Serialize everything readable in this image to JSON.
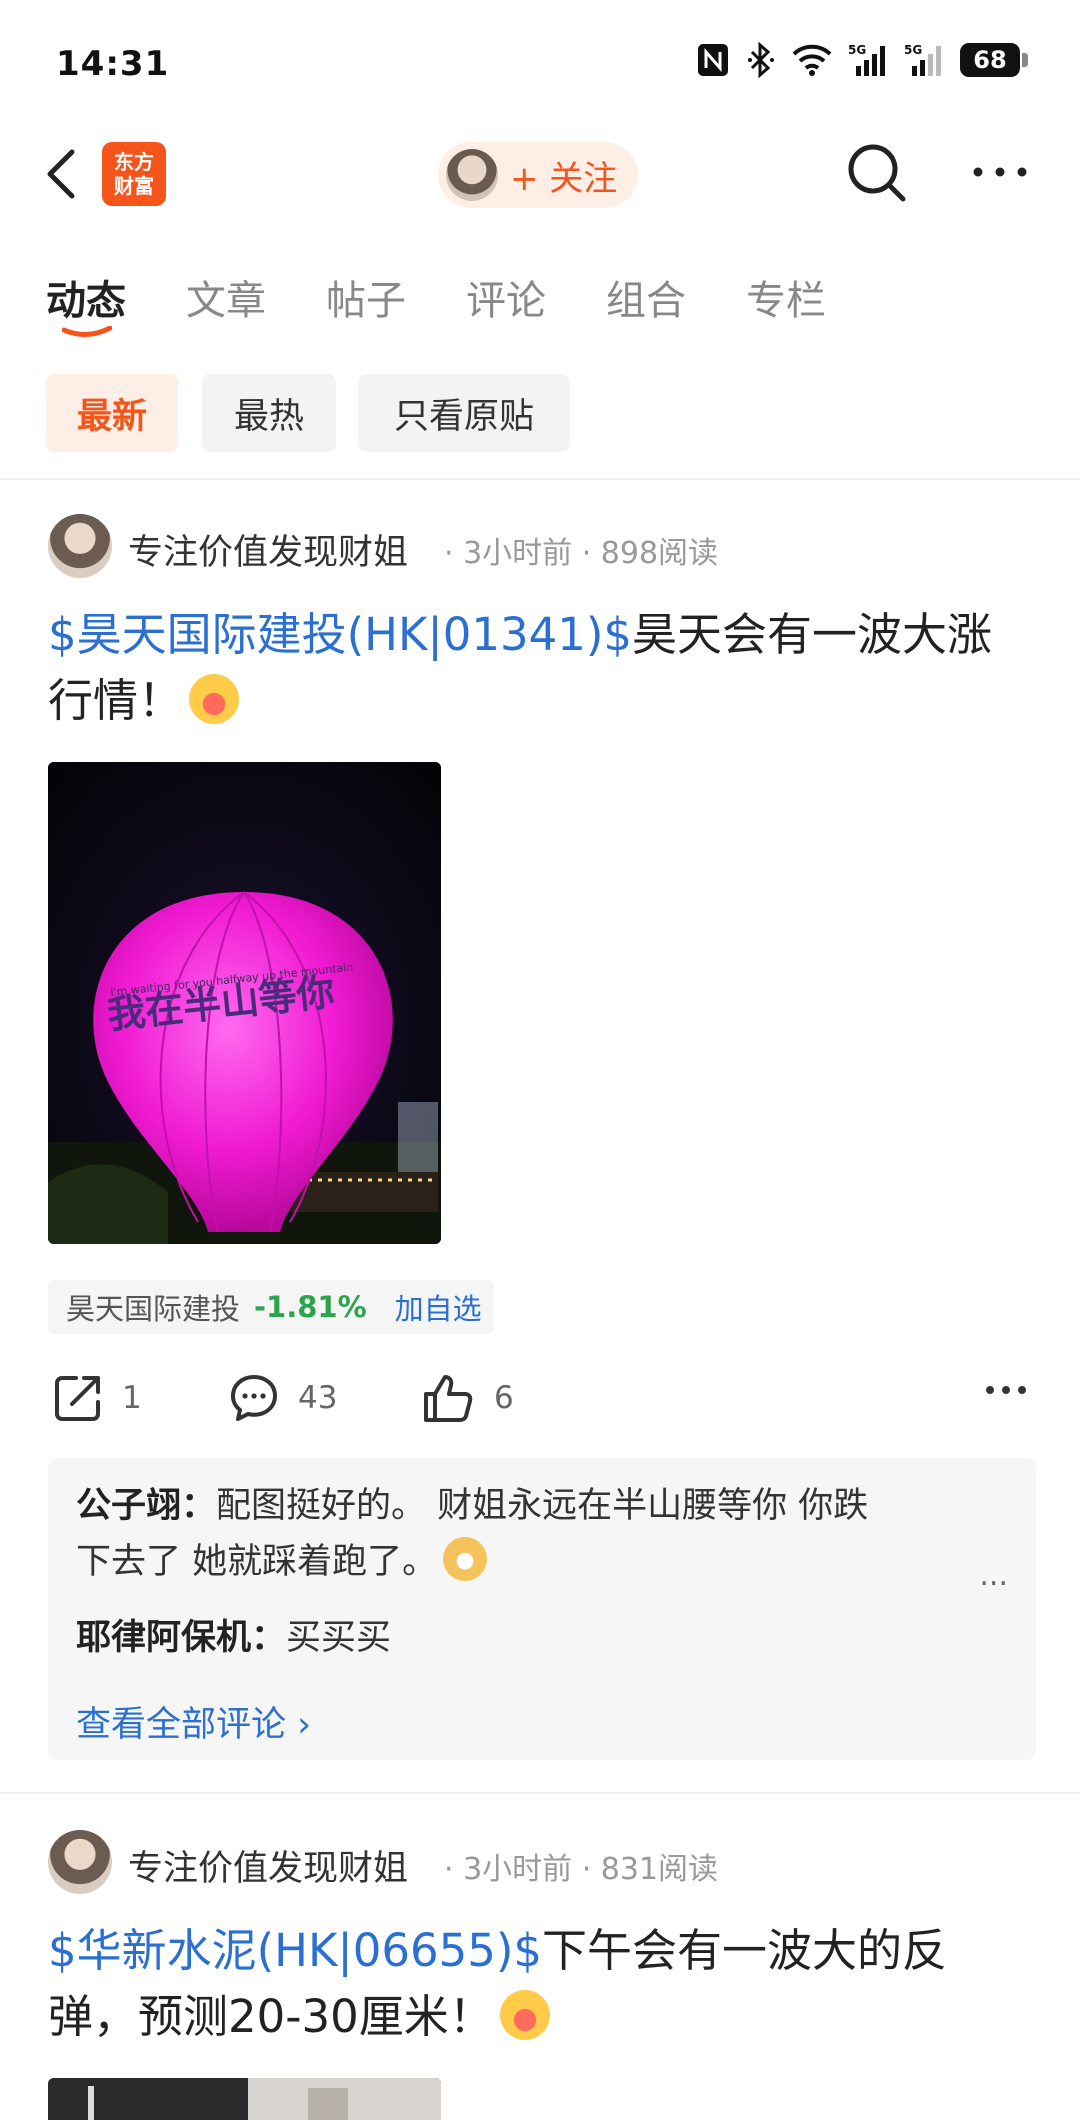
{
  "status_bar": {
    "time": "14:31",
    "battery": "68",
    "network_1": "5G",
    "network_2": "5G"
  },
  "nav": {
    "logo_line1": "东方",
    "logo_line2": "财富",
    "follow_label": "+ 关注"
  },
  "tabs": [
    {
      "label": "动态"
    },
    {
      "label": "文章"
    },
    {
      "label": "帖子"
    },
    {
      "label": "评论"
    },
    {
      "label": "组合"
    },
    {
      "label": "专栏"
    }
  ],
  "filters": [
    {
      "label": "最新"
    },
    {
      "label": "最热"
    },
    {
      "label": "只看原贴"
    }
  ],
  "posts": [
    {
      "author": "专注价值发现财姐",
      "meta": "· 3小时前 · 898阅读",
      "stock_link": "$昊天国际建投(HK|01341)$",
      "text_line1_rest": "昊天会有一波大涨",
      "text_line2": "行情！",
      "image_text": "我在半山等你",
      "image_subtext": "I'm waiting for you halfway up the mountain",
      "stock_tag": {
        "name": "昊天国际建投",
        "change": "-1.81%",
        "add": "加自选"
      },
      "shares": "1",
      "comments": "43",
      "likes": "6",
      "comment_list": [
        {
          "name": "公子翊：",
          "text": "配图挺好的。 财姐永远在半山腰等你 你跌",
          "text2": "下去了 她就踩着跑了。"
        },
        {
          "name": "耶律阿保机：",
          "text": "买买买"
        }
      ],
      "view_all": "查看全部评论 ›",
      "comment_more": "..."
    },
    {
      "author": "专注价值发现财姐",
      "meta": "· 3小时前 · 831阅读",
      "stock_link": "$华新水泥(HK|06655)$",
      "text_line1_rest": "下午会有一波大的反",
      "text_line2": "弹，预测20-30厘米！"
    }
  ],
  "colors": {
    "brand": "#f5541a",
    "link": "#2a6fd1",
    "down": "#2ca44e"
  }
}
